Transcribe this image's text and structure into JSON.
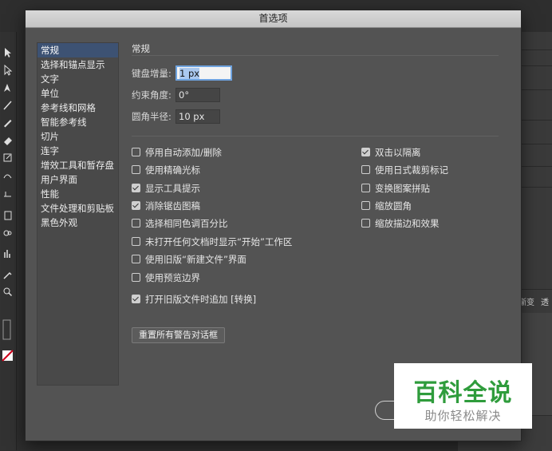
{
  "dialog": {
    "title": "首选项"
  },
  "sidebar": {
    "items": [
      {
        "label": "常规"
      },
      {
        "label": "选择和锚点显示"
      },
      {
        "label": "文字"
      },
      {
        "label": "单位"
      },
      {
        "label": "参考线和网格"
      },
      {
        "label": "智能参考线"
      },
      {
        "label": "切片"
      },
      {
        "label": "连字"
      },
      {
        "label": "增效工具和暂存盘"
      },
      {
        "label": "用户界面"
      },
      {
        "label": "性能"
      },
      {
        "label": "文件处理和剪贴板"
      },
      {
        "label": "黑色外观"
      }
    ],
    "selected": "常规"
  },
  "general": {
    "section_title": "常规",
    "keyboard_increment": {
      "label": "键盘增量:",
      "value": "1 px"
    },
    "constrain_angle": {
      "label": "约束角度:",
      "value": "0°"
    },
    "corner_radius": {
      "label": "圆角半径:",
      "value": "10 px"
    },
    "options_left": [
      {
        "label": "停用自动添加/删除",
        "checked": false
      },
      {
        "label": "使用精确光标",
        "checked": false
      },
      {
        "label": "显示工具提示",
        "checked": true
      },
      {
        "label": "消除锯齿图稿",
        "checked": true
      },
      {
        "label": "选择相同色调百分比",
        "checked": false
      },
      {
        "label": "未打开任何文档时显示“开始”工作区",
        "checked": false
      },
      {
        "label": "使用旧版“新建文件”界面",
        "checked": false
      },
      {
        "label": "使用预览边界",
        "checked": false
      }
    ],
    "options_right": [
      {
        "label": "双击以隔离",
        "checked": true
      },
      {
        "label": "使用日式裁剪标记",
        "checked": false
      },
      {
        "label": "变换图案拼贴",
        "checked": false
      },
      {
        "label": "缩放圆角",
        "checked": false
      },
      {
        "label": "缩放描边和效果",
        "checked": false
      }
    ],
    "append_convert": {
      "label": "打开旧版文件时追加 [转换]",
      "checked": true
    },
    "reset_button": "重置所有警告对话框"
  },
  "background_app": {
    "panel_tabs": [
      "渐变",
      "透"
    ]
  },
  "watermark": {
    "main": "百科全说",
    "sub": "助你轻松解决"
  }
}
